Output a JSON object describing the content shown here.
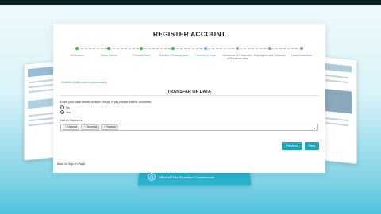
{
  "page": {
    "title": "REGISTER ACCOUNT",
    "success_message": "Student details saved successfully",
    "section_title": "TRANSFER OF DATA",
    "question": "Does your data reside outside Kenya, if yes please list the countries.",
    "radio": [
      {
        "label": "No",
        "checked": false
      },
      {
        "label": "Yes",
        "checked": true
      }
    ],
    "list_label": "List of Countries",
    "countries": [
      "Uganda",
      "Tanzania",
      "Rwanda"
    ],
    "previous_label": "Previous",
    "next_label": "Next",
    "back_link": "Back to Sign in Page",
    "footer_text": "Office of Data Protection Commissioner"
  },
  "steps": [
    {
      "label": "Verification",
      "state": "done"
    },
    {
      "label": "Basic Details",
      "state": "done"
    },
    {
      "label": "Personal Data",
      "state": "done"
    },
    {
      "label": "Sensitive Personal data",
      "state": "done"
    },
    {
      "label": "Transfer of Data",
      "state": "active"
    },
    {
      "label": "Measures of Protection of Personal data",
      "state": "pending"
    },
    {
      "label": "Employees and Turnover",
      "state": "pending"
    },
    {
      "label": "Data Controllers",
      "state": "pending"
    }
  ],
  "colors": {
    "accent": "#1fa3b8",
    "done": "#3cb24d",
    "pending": "#8f9aa3"
  }
}
